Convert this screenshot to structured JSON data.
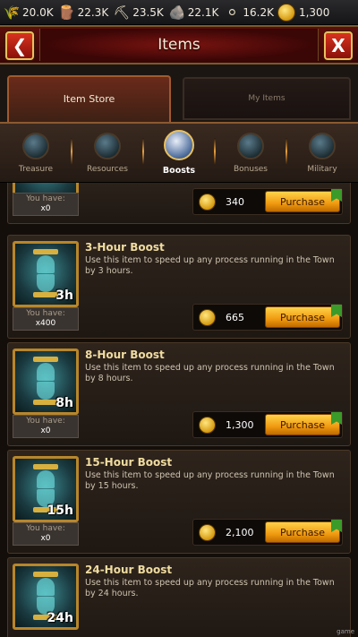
{
  "resources": [
    {
      "icon": "wheat-icon",
      "glyph": "🌾",
      "value": "20.0K"
    },
    {
      "icon": "wood-icon",
      "glyph": "🪵",
      "value": "22.3K"
    },
    {
      "icon": "iron-icon",
      "glyph": "⛏",
      "value": "23.5K"
    },
    {
      "icon": "stone-icon",
      "glyph": "🪨",
      "value": "22.1K"
    },
    {
      "icon": "silver-icon",
      "glyph": "⚪",
      "value": "16.2K"
    },
    {
      "icon": "gold-coin-icon",
      "glyph": "",
      "value": "1,300"
    }
  ],
  "header": {
    "title": "Items",
    "back_glyph": "❮",
    "close_glyph": "X"
  },
  "tabs": {
    "store": "Item Store",
    "my_items": "My Items"
  },
  "categories": [
    {
      "label": "Treasure",
      "icon": "treasure-icon"
    },
    {
      "label": "Resources",
      "icon": "resources-icon"
    },
    {
      "label": "Boosts",
      "icon": "boosts-icon",
      "active": true
    },
    {
      "label": "Bonuses",
      "icon": "bonuses-icon"
    },
    {
      "label": "Military",
      "icon": "military-icon"
    }
  ],
  "items": [
    {
      "name": "",
      "desc": "",
      "duration": "",
      "have_label": "You have:",
      "have_count": "x0",
      "price": "340",
      "buy_label": "Purchase"
    },
    {
      "name": "3-Hour Boost",
      "desc": "Use this item to speed up any process running in the Town by 3 hours.",
      "duration": "3h",
      "have_label": "You have:",
      "have_count": "x400",
      "price": "665",
      "buy_label": "Purchase"
    },
    {
      "name": "8-Hour Boost",
      "desc": "Use this item to speed up any process running in the Town by 8 hours.",
      "duration": "8h",
      "have_label": "You have:",
      "have_count": "x0",
      "price": "1,300",
      "buy_label": "Purchase"
    },
    {
      "name": "15-Hour Boost",
      "desc": "Use this item to speed up any process running in the Town by 15 hours.",
      "duration": "15h",
      "have_label": "You have:",
      "have_count": "x0",
      "price": "2,100",
      "buy_label": "Purchase"
    },
    {
      "name": "24-Hour Boost",
      "desc": "Use this item to speed up any process running in the Town by 24 hours.",
      "duration": "24h",
      "have_label": "",
      "have_count": "",
      "price": "",
      "buy_label": ""
    }
  ],
  "watermark": "game"
}
